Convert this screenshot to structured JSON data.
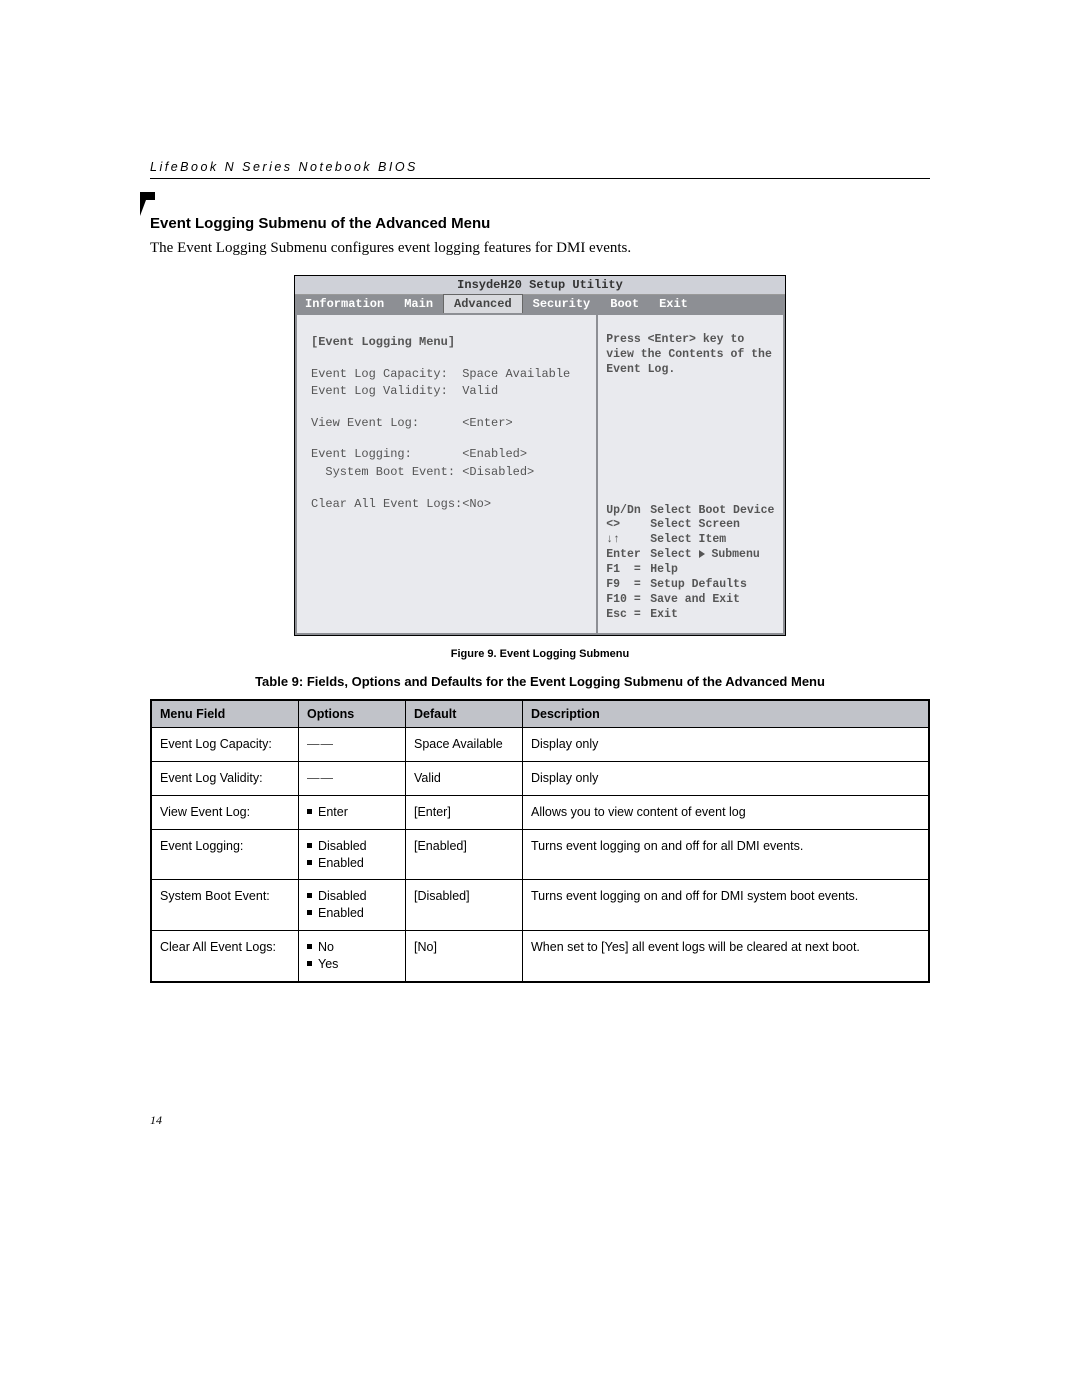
{
  "running_head": "LifeBook N Series Notebook BIOS",
  "section_title": "Event Logging Submenu of the Advanced Menu",
  "section_desc": "The Event Logging Submenu configures event logging features for DMI events.",
  "bios": {
    "title": "InsydeH20 Setup Utility",
    "tabs": [
      "Information",
      "Main",
      "Advanced",
      "Security",
      "Boot",
      "Exit"
    ],
    "active_tab": "Advanced",
    "menu_header": "[Event Logging Menu]",
    "rows_status": [
      {
        "label": "Event Log Capacity:",
        "value": "Space Available"
      },
      {
        "label": "Event Log Validity:",
        "value": "Valid"
      }
    ],
    "rows_action": [
      {
        "label": "View Event Log:",
        "value": "<Enter>"
      }
    ],
    "rows_toggle": [
      {
        "label": "Event Logging:",
        "value": "<Enabled>"
      },
      {
        "label": "  System Boot Event:",
        "value": "<Disabled>"
      }
    ],
    "rows_clear": [
      {
        "label": "Clear All Event Logs:",
        "value": "<No>"
      }
    ],
    "help_text": "Press <Enter> key to view the Contents of the Event Log.",
    "nav": [
      {
        "key": "Up/Dn",
        "desc": "Select Boot Device"
      },
      {
        "key": "<>",
        "desc": "Select Screen"
      },
      {
        "key": "↓↑",
        "desc": "Select Item"
      },
      {
        "key": "Enter",
        "desc_prefix": "Select ",
        "desc_suffix": " Submenu",
        "triangle": true
      },
      {
        "key": "F1  =",
        "desc": "Help"
      },
      {
        "key": "F9  =",
        "desc": "Setup Defaults"
      },
      {
        "key": "F10 =",
        "desc": "Save and Exit"
      },
      {
        "key": "Esc =",
        "desc": "Exit"
      }
    ]
  },
  "figure_caption": "Figure 9.  Event Logging Submenu",
  "table_title": "Table 9: Fields, Options and Defaults for the Event Logging Submenu of the Advanced Menu",
  "table": {
    "headers": [
      "Menu Field",
      "Options",
      "Default",
      "Description"
    ],
    "rows": [
      {
        "field": "Event Log Capacity:",
        "options": [
          "—"
        ],
        "dash": true,
        "default": "Space Available",
        "desc": "Display only"
      },
      {
        "field": "Event Log Validity:",
        "options": [
          "—"
        ],
        "dash": true,
        "default": "Valid",
        "desc": "Display only"
      },
      {
        "field": "View Event Log:",
        "options": [
          "Enter"
        ],
        "default": "[Enter]",
        "desc": "Allows you to view content of event log"
      },
      {
        "field": "Event Logging:",
        "options": [
          "Disabled",
          "Enabled"
        ],
        "default": "[Enabled]",
        "desc": "Turns event logging on and off for all DMI events."
      },
      {
        "field": "System Boot Event:",
        "options": [
          "Disabled",
          "Enabled"
        ],
        "default": "[Disabled]",
        "desc": "Turns event logging on and off for DMI system boot events."
      },
      {
        "field": "Clear All Event Logs:",
        "options": [
          "No",
          "Yes"
        ],
        "default": "[No]",
        "desc": "When set to [Yes] all event logs will be cleared at next boot."
      }
    ]
  },
  "page_number": "14"
}
